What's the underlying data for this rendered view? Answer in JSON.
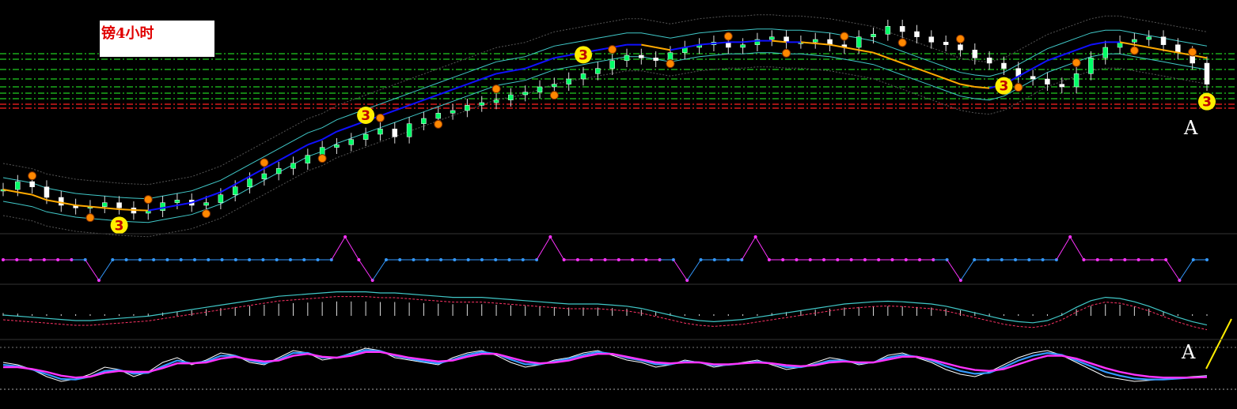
{
  "chart_data": {
    "type": "candlestick",
    "title": "镑4小时",
    "annotations": {
      "setup_count_label": "3",
      "marker_A": "A"
    },
    "colors": {
      "background": "#000000",
      "candle_up": "#ffffff",
      "candle_down": "#ffffff",
      "candle_body": "#00ff66",
      "ma_bull": "#1010ff",
      "ma_bear": "#ffaa00",
      "bands": "#40c8c8",
      "support_green": "#22cc22",
      "resistance_red": "#ff2020",
      "count_marker": "#ffee00",
      "count_small": "#ff8800",
      "signal_magenta": "#ff33ff",
      "signal_blue": "#3399ff",
      "macd_line": "#40c8c8",
      "stoch_white": "#ffffff",
      "stoch_blue": "#3399ff",
      "stoch_magenta": "#ff33ff",
      "trend_arrow": "#ffee00"
    },
    "price_series": [
      2.0,
      2.3,
      2.1,
      1.7,
      1.4,
      1.3,
      1.35,
      1.5,
      1.3,
      1.1,
      1.2,
      1.5,
      1.6,
      1.4,
      1.5,
      1.8,
      2.1,
      2.4,
      2.6,
      2.8,
      3.0,
      3.3,
      3.6,
      3.7,
      3.9,
      4.1,
      4.3,
      4.0,
      4.5,
      4.7,
      4.9,
      5.0,
      5.2,
      5.3,
      5.4,
      5.6,
      5.7,
      5.9,
      6.0,
      6.2,
      6.4,
      6.6,
      6.9,
      7.1,
      7.0,
      6.9,
      7.2,
      7.4,
      7.5,
      7.6,
      7.4,
      7.5,
      7.7,
      7.8,
      7.6,
      7.6,
      7.7,
      7.5,
      7.4,
      7.8,
      7.9,
      8.2,
      8.0,
      7.8,
      7.6,
      7.5,
      7.3,
      7.0,
      6.8,
      6.6,
      6.3,
      6.2,
      6.0,
      5.9,
      6.4,
      7.0,
      7.4,
      7.6,
      7.7,
      7.8,
      7.5,
      7.2,
      6.8,
      6.0
    ],
    "ma_series": [
      2.0,
      1.9,
      1.8,
      1.6,
      1.5,
      1.4,
      1.35,
      1.3,
      1.25,
      1.22,
      1.2,
      1.3,
      1.4,
      1.5,
      1.7,
      1.9,
      2.2,
      2.5,
      2.8,
      3.1,
      3.4,
      3.7,
      3.9,
      4.2,
      4.4,
      4.6,
      4.8,
      5.0,
      5.2,
      5.4,
      5.6,
      5.8,
      6.0,
      6.2,
      6.4,
      6.5,
      6.6,
      6.8,
      7.0,
      7.1,
      7.2,
      7.3,
      7.4,
      7.5,
      7.5,
      7.4,
      7.3,
      7.4,
      7.5,
      7.55,
      7.6,
      7.6,
      7.65,
      7.65,
      7.6,
      7.6,
      7.55,
      7.5,
      7.4,
      7.3,
      7.2,
      7.0,
      6.8,
      6.6,
      6.4,
      6.2,
      6.0,
      5.9,
      5.85,
      6.0,
      6.3,
      6.6,
      6.9,
      7.1,
      7.3,
      7.5,
      7.6,
      7.6,
      7.5,
      7.4,
      7.3,
      7.2,
      7.1,
      7.0
    ],
    "stoch_white": [
      60,
      55,
      45,
      30,
      20,
      25,
      35,
      50,
      45,
      30,
      40,
      60,
      70,
      55,
      65,
      80,
      75,
      60,
      55,
      70,
      85,
      80,
      65,
      70,
      80,
      90,
      85,
      70,
      65,
      60,
      55,
      70,
      80,
      85,
      75,
      60,
      50,
      55,
      65,
      70,
      80,
      85,
      75,
      65,
      60,
      50,
      55,
      65,
      60,
      50,
      55,
      60,
      65,
      55,
      45,
      50,
      60,
      70,
      65,
      55,
      60,
      75,
      80,
      70,
      60,
      45,
      35,
      30,
      40,
      55,
      70,
      80,
      85,
      75,
      60,
      45,
      30,
      25,
      20,
      22,
      25,
      28,
      30,
      32
    ],
    "stoch_blue": [
      55,
      52,
      45,
      35,
      25,
      24,
      30,
      42,
      44,
      36,
      38,
      52,
      64,
      58,
      62,
      74,
      74,
      64,
      58,
      66,
      80,
      80,
      70,
      70,
      78,
      86,
      84,
      74,
      68,
      62,
      58,
      66,
      76,
      82,
      78,
      66,
      56,
      56,
      62,
      68,
      76,
      82,
      78,
      70,
      64,
      56,
      56,
      62,
      60,
      54,
      55,
      58,
      62,
      58,
      50,
      50,
      56,
      64,
      64,
      58,
      60,
      70,
      76,
      72,
      64,
      52,
      42,
      36,
      38,
      50,
      64,
      74,
      80,
      76,
      64,
      52,
      40,
      32,
      26,
      24,
      24,
      26,
      28,
      30
    ],
    "stoch_magenta": [
      50,
      50,
      46,
      40,
      32,
      28,
      30,
      38,
      42,
      40,
      40,
      48,
      58,
      58,
      60,
      68,
      72,
      66,
      62,
      64,
      74,
      78,
      72,
      70,
      74,
      82,
      82,
      76,
      70,
      66,
      62,
      64,
      72,
      78,
      78,
      70,
      62,
      58,
      60,
      64,
      72,
      78,
      78,
      72,
      66,
      60,
      58,
      60,
      60,
      56,
      56,
      58,
      60,
      58,
      54,
      52,
      54,
      60,
      62,
      60,
      60,
      66,
      72,
      72,
      66,
      58,
      50,
      44,
      42,
      46,
      56,
      66,
      74,
      74,
      68,
      58,
      48,
      40,
      34,
      30,
      28,
      28,
      28,
      29
    ],
    "macd_series": [
      30,
      28,
      26,
      24,
      22,
      20,
      20,
      22,
      24,
      26,
      28,
      32,
      36,
      40,
      44,
      48,
      52,
      56,
      60,
      64,
      66,
      68,
      70,
      72,
      72,
      72,
      70,
      70,
      68,
      66,
      64,
      62,
      62,
      62,
      60,
      58,
      56,
      54,
      52,
      50,
      50,
      50,
      48,
      46,
      42,
      36,
      30,
      24,
      20,
      18,
      20,
      22,
      26,
      30,
      34,
      38,
      42,
      46,
      50,
      52,
      54,
      55,
      54,
      52,
      50,
      46,
      40,
      34,
      28,
      22,
      18,
      16,
      20,
      30,
      44,
      56,
      62,
      60,
      54,
      46,
      36,
      26,
      18,
      12
    ],
    "signal_states": [
      1,
      1,
      1,
      1,
      1,
      1,
      0,
      -1,
      0,
      0,
      0,
      0,
      0,
      0,
      0,
      0,
      0,
      0,
      0,
      0,
      0,
      0,
      0,
      0,
      0,
      2,
      1,
      -1,
      0,
      0,
      0,
      0,
      0,
      0,
      0,
      0,
      0,
      0,
      0,
      0,
      2,
      1,
      1,
      1,
      1,
      1,
      1,
      1,
      1,
      0,
      -1,
      0,
      0,
      0,
      0,
      2,
      1,
      1,
      1,
      1,
      1,
      1,
      1,
      1,
      1,
      1,
      1,
      1,
      1,
      0,
      -1,
      0,
      0,
      0,
      0,
      0,
      0,
      0,
      2,
      1,
      1,
      1,
      1,
      1,
      1,
      1,
      -1,
      0,
      0
    ]
  }
}
